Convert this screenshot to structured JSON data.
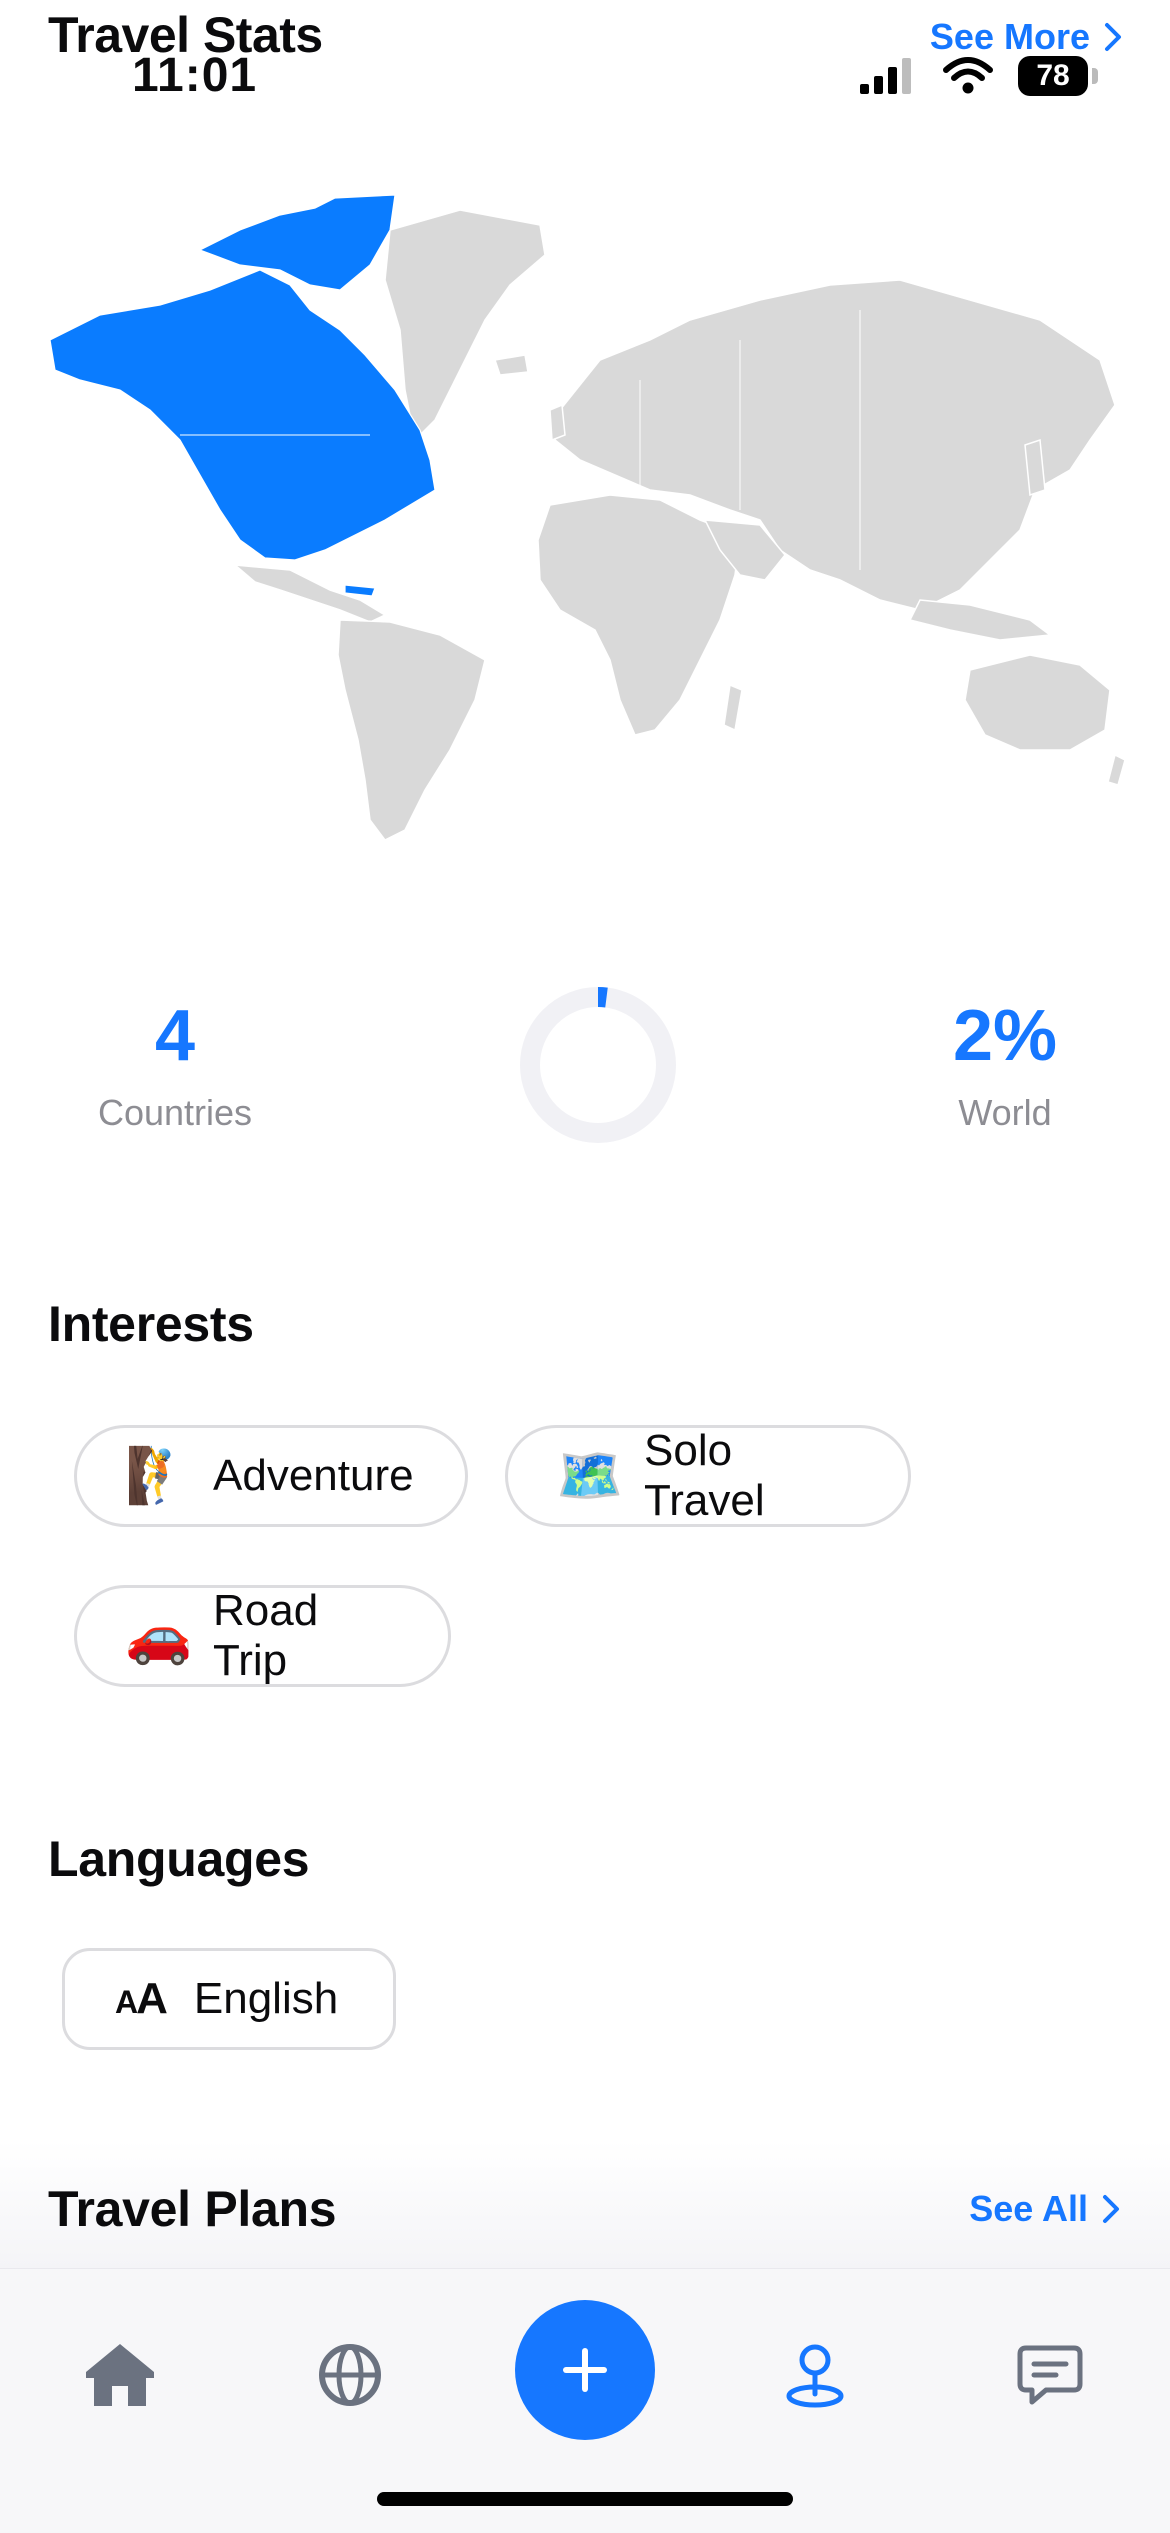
{
  "header": {
    "title": "Travel Stats",
    "time": "11:01",
    "see_more_label": "See More",
    "battery_level": "78"
  },
  "stats": {
    "countries_value": "4",
    "countries_label": "Countries",
    "world_value": "2%",
    "world_label": "World",
    "world_fraction": 0.02
  },
  "interests": {
    "title": "Interests",
    "items": [
      {
        "emoji": "🧗",
        "label": "Adventure"
      },
      {
        "emoji": "🗺️",
        "label": "Solo Travel"
      },
      {
        "emoji": "🚗",
        "label": "Road Trip"
      }
    ]
  },
  "languages": {
    "title": "Languages",
    "items": [
      {
        "icon_text": "AA",
        "label": "English"
      }
    ]
  },
  "travel_plans": {
    "title": "Travel Plans",
    "see_all_label": "See All"
  },
  "nav": {
    "items": [
      "home-icon",
      "globe-icon",
      "add-icon",
      "map-pin-icon",
      "chat-icon"
    ],
    "active": "map-pin-icon"
  },
  "colors": {
    "accent": "#1677ff",
    "visited_region": "#0a7cff",
    "unvisited_land": "#d9d9d9"
  }
}
